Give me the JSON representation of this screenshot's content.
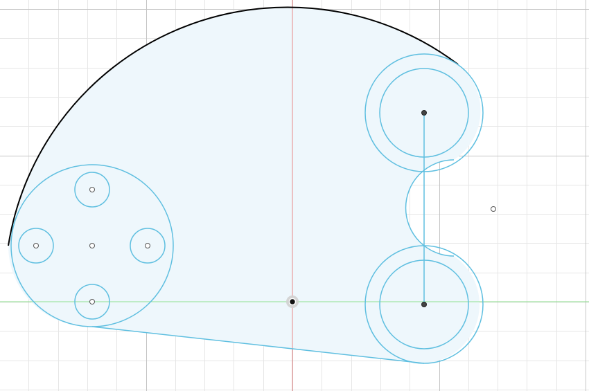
{
  "colors": {
    "background": "#ffffff",
    "grid_minor": "#e6e6e6",
    "grid_major": "#c4c4c4",
    "axis_vertical": "#e88888",
    "axis_horizontal": "#8fe08f",
    "profile_fill": "#eef7fc",
    "sketch_line": "#5fbfe0",
    "selected_arc": "#000000",
    "origin_halo": "#b8b8b8",
    "origin_point": "#111111",
    "point_fill": "#ffffff",
    "point_stroke": "#555555",
    "center_point_fill": "#444444"
  },
  "sketch": {
    "view": "sketch-plane-top",
    "elements": [
      "outer-profile",
      "outer-arc",
      "bolt-circle",
      "bolt-hole-top",
      "bolt-hole-left",
      "bolt-hole-right",
      "bolt-hole-bottom",
      "boss-top-outer",
      "boss-top-inner",
      "boss-bottom-outer",
      "boss-bottom-inner",
      "center-link-line",
      "fillet-arc",
      "origin-point",
      "sketch-point"
    ]
  }
}
